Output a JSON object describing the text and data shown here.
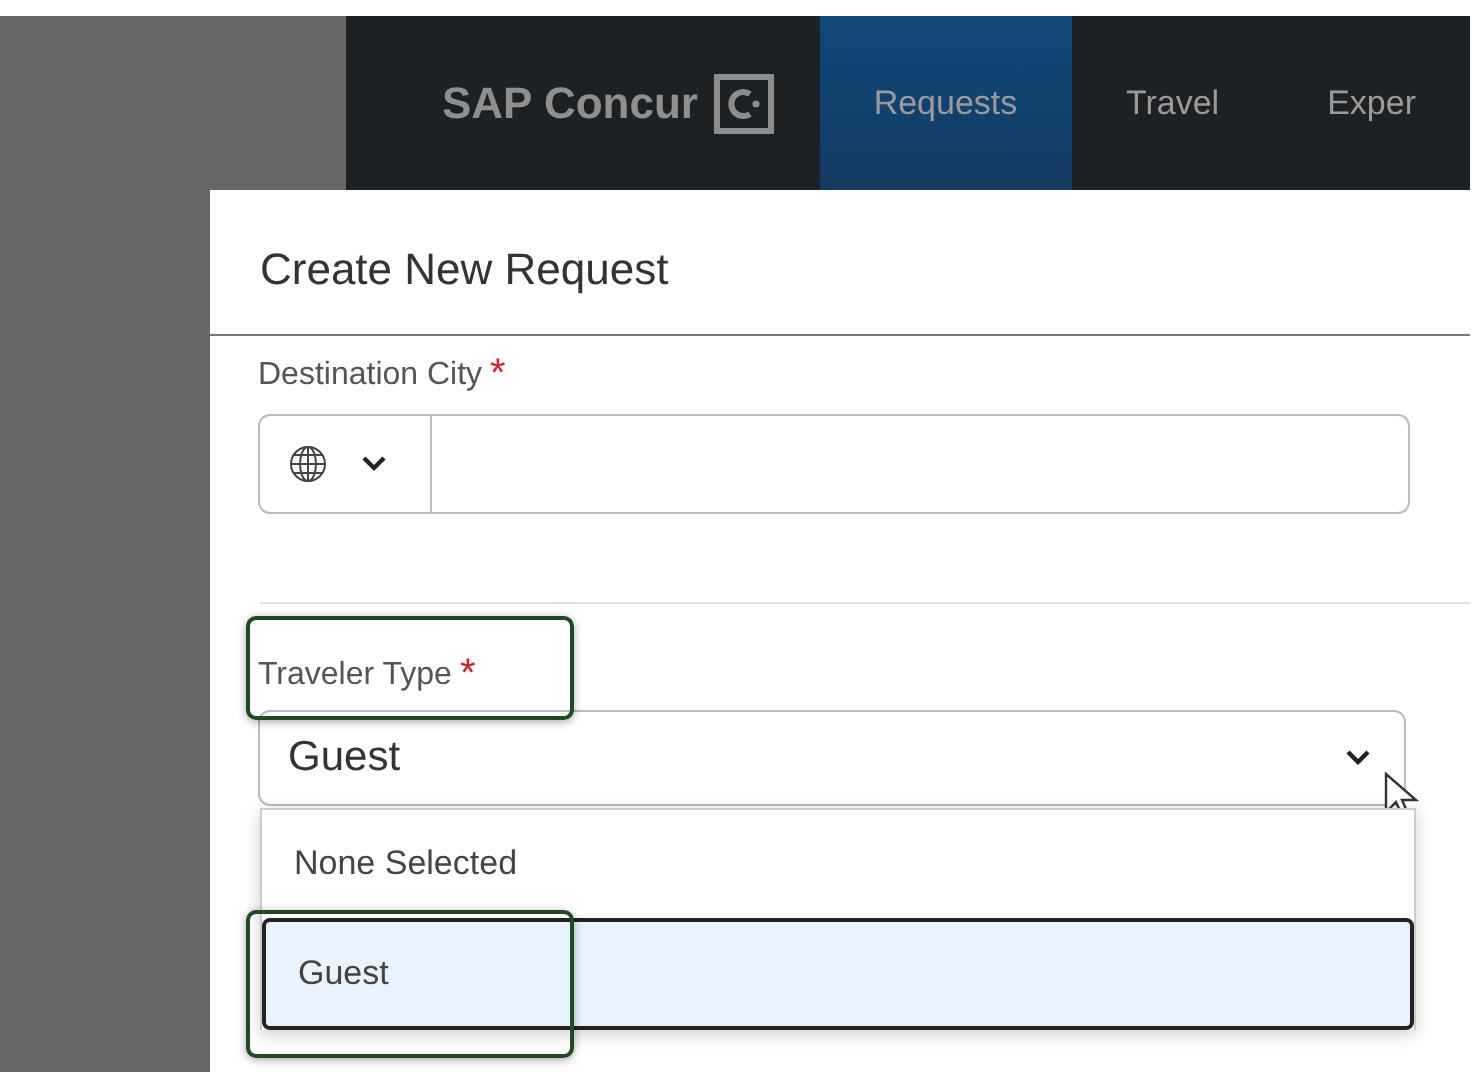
{
  "nav": {
    "logo": "SAP Concur",
    "tabs": [
      {
        "label": "Requests",
        "selected": true
      },
      {
        "label": "Travel",
        "selected": false
      },
      {
        "label": "Exper",
        "selected": false
      }
    ]
  },
  "dialog": {
    "title": "Create New Request",
    "fields": [
      {
        "kind": "city",
        "label": "Destination City",
        "required_mark": "*"
      },
      {
        "kind": "select",
        "label": "Traveler Type",
        "required_mark": "*",
        "highlighted": true,
        "value": "Guest",
        "expanded": true,
        "options": [
          {
            "label": "None Selected",
            "selected": false,
            "highlighted": false
          },
          {
            "label": "Guest",
            "selected": true,
            "highlighted": true
          }
        ]
      }
    ]
  }
}
